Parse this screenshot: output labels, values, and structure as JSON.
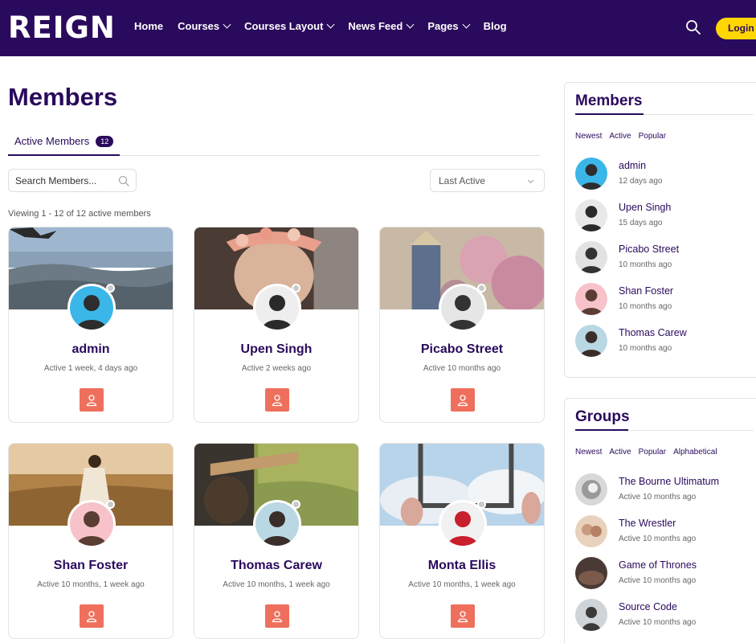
{
  "header": {
    "logo": "REIGN",
    "nav": [
      {
        "label": "Home",
        "dropdown": false
      },
      {
        "label": "Courses",
        "dropdown": true
      },
      {
        "label": "Courses Layout",
        "dropdown": true
      },
      {
        "label": "News Feed",
        "dropdown": true
      },
      {
        "label": "Pages",
        "dropdown": true
      },
      {
        "label": "Blog",
        "dropdown": false
      }
    ],
    "login_label": "Login"
  },
  "main": {
    "title": "Members",
    "tab_label": "Active Members",
    "tab_count": "12",
    "search_placeholder": "Search Members...",
    "sort_selected": "Last Active",
    "viewing_text": "Viewing 1 - 12 of 12 active members",
    "members": [
      {
        "name": "admin",
        "active": "Active 1 week, 4 days ago"
      },
      {
        "name": "Upen Singh",
        "active": "Active 2 weeks ago"
      },
      {
        "name": "Picabo Street",
        "active": "Active 10 months ago"
      },
      {
        "name": "Shan Foster",
        "active": "Active 10 months, 1 week ago"
      },
      {
        "name": "Thomas Carew",
        "active": "Active 10 months, 1 week ago"
      },
      {
        "name": "Monta Ellis",
        "active": "Active 10 months, 1 week ago"
      }
    ]
  },
  "sidebar": {
    "members_widget": {
      "title": "Members",
      "tabs": [
        "Newest",
        "Active",
        "Popular"
      ],
      "items": [
        {
          "name": "admin",
          "time": "12 days ago"
        },
        {
          "name": "Upen Singh",
          "time": "15 days ago"
        },
        {
          "name": "Picabo Street",
          "time": "10 months ago"
        },
        {
          "name": "Shan Foster",
          "time": "10 months ago"
        },
        {
          "name": "Thomas Carew",
          "time": "10 months ago"
        }
      ]
    },
    "groups_widget": {
      "title": "Groups",
      "tabs": [
        "Newest",
        "Active",
        "Popular",
        "Alphabetical"
      ],
      "items": [
        {
          "name": "The Bourne Ultimatum",
          "time": "Active 10 months ago"
        },
        {
          "name": "The Wrestler",
          "time": "Active 10 months ago"
        },
        {
          "name": "Game of Thrones",
          "time": "Active 10 months ago"
        },
        {
          "name": "Source Code",
          "time": "Active 10 months ago"
        }
      ]
    }
  },
  "colors": {
    "header_bg": "#2a0a5c",
    "accent": "#2a0a5c",
    "login_bg": "#ffd600",
    "profile_button": "#ef6f5d"
  }
}
